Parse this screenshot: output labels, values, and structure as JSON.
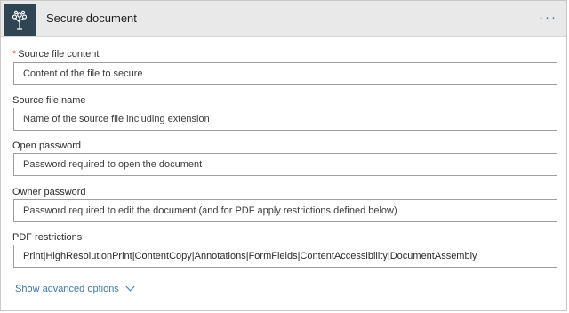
{
  "header": {
    "title": "Secure document",
    "more_label": "···",
    "logo_icon": "tree-icon",
    "logo_color": "#2f4554"
  },
  "fields": {
    "source_content": {
      "label": "Source file content",
      "required_marker": "*",
      "placeholder": "Content of the file to secure"
    },
    "source_name": {
      "label": "Source file name",
      "placeholder": "Name of the source file including extension"
    },
    "open_password": {
      "label": "Open password",
      "placeholder": "Password required to open the document"
    },
    "owner_password": {
      "label": "Owner password",
      "placeholder": "Password required to edit the document (and for PDF apply restrictions defined below)"
    },
    "pdf_restrictions": {
      "label": "PDF restrictions",
      "value": "Print|HighResolutionPrint|ContentCopy|Annotations|FormFields|ContentAccessibility|DocumentAssembly"
    }
  },
  "advanced": {
    "label": "Show advanced options"
  },
  "colors": {
    "required": "#d13438",
    "link": "#3c78b5",
    "header_bg": "#e9e9e9"
  }
}
